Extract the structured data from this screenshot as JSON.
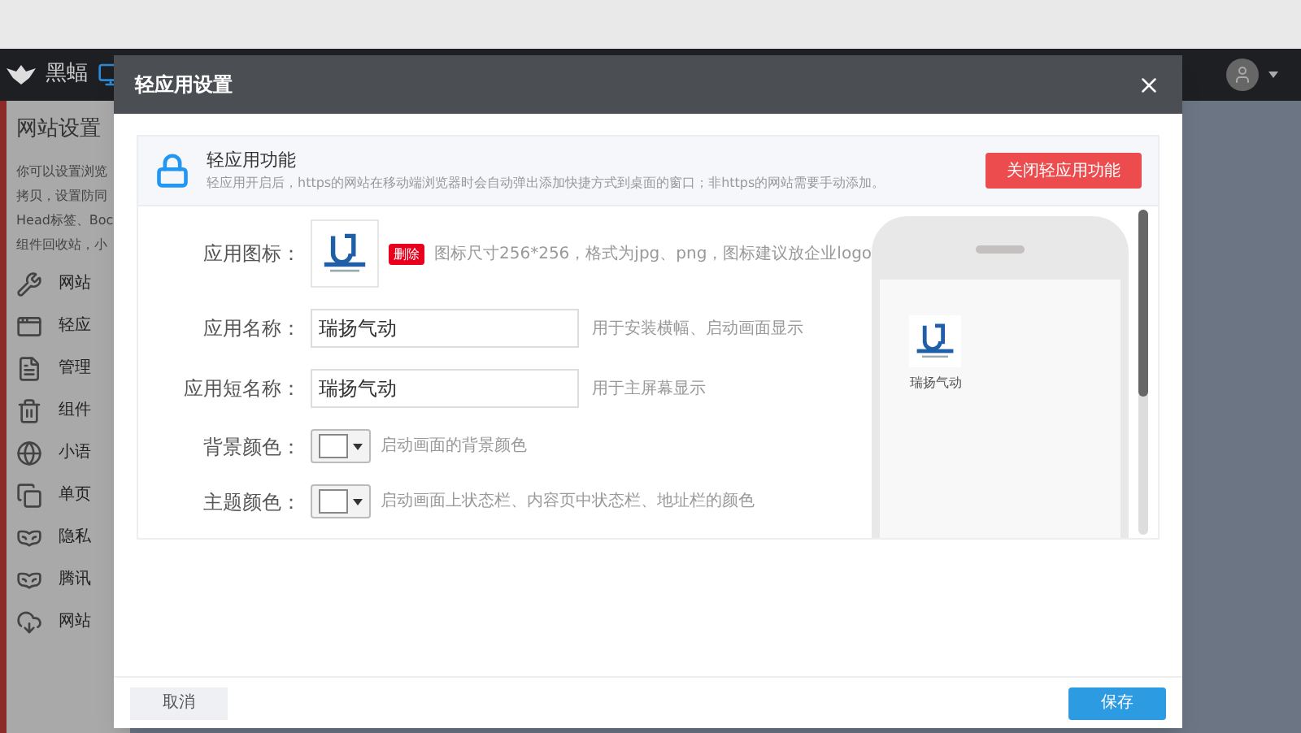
{
  "header": {
    "logo_text": "黑蝠"
  },
  "sidebar": {
    "title": "网站设置",
    "description_lines": [
      "你可以设置浏览",
      "拷贝，设置防同",
      "Head标签、Boc",
      "组件回收站，小"
    ],
    "items": [
      {
        "label": "网站"
      },
      {
        "label": "轻应"
      },
      {
        "label": "管理"
      },
      {
        "label": "组件"
      },
      {
        "label": "小语"
      },
      {
        "label": "单页"
      },
      {
        "label": "隐私"
      },
      {
        "label": "腾讯"
      },
      {
        "label": "网站"
      }
    ]
  },
  "dialog": {
    "title": "轻应用设置",
    "notice": {
      "title": "轻应用功能",
      "description": "轻应用开启后，https的网站在移动端浏览器时会自动弹出添加快捷方式到桌面的窗口；非https的网站需要手动添加。",
      "button": "关闭轻应用功能"
    },
    "form": [
      {
        "kind": "image",
        "label": "应用图标：",
        "action": "删除",
        "hint": "图标尺寸256*256，格式为jpg、png，图标建议放企业logo"
      },
      {
        "kind": "text",
        "label": "应用名称：",
        "value": "瑞扬气动",
        "hint": "用于安装横幅、启动画面显示"
      },
      {
        "kind": "text",
        "label": "应用短名称：",
        "value": "瑞扬气动",
        "hint": "用于主屏幕显示"
      },
      {
        "kind": "color",
        "label": "背景颜色：",
        "hint": "启动画面的背景颜色"
      },
      {
        "kind": "color",
        "label": "主题颜色：",
        "hint": "启动画面上状态栏、内容页中状态栏、地址栏的颜色"
      }
    ],
    "preview": {
      "app_name": "瑞扬气动"
    },
    "buttons": {
      "cancel": "取消",
      "save": "保存"
    }
  }
}
